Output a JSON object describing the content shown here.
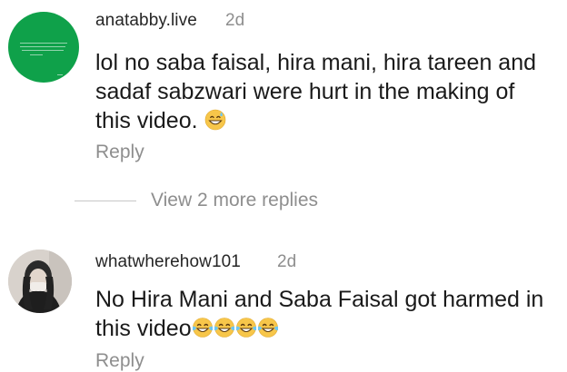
{
  "comments": [
    {
      "username": "anatabby.live",
      "time": "2d",
      "text_lines": [
        "lol no saba faisal, hira mani, hira tareen and",
        "sadaf sabzwari were hurt in the making of",
        "this video."
      ],
      "emoji": [
        "grinning-sweat-emoji"
      ],
      "reply_label": "Reply",
      "avatar": "green-square-avatar"
    },
    {
      "username": "whatwherehow101",
      "time": "2d",
      "text_lines": [
        "No Hira Mani and Saba Faisal got harmed in",
        "this video"
      ],
      "emoji": [
        "tears-of-joy-emoji",
        "tears-of-joy-emoji",
        "tears-of-joy-emoji",
        "tears-of-joy-emoji"
      ],
      "reply_label": "Reply",
      "avatar": "profile-photo-avatar"
    }
  ],
  "view_more_replies": "View 2 more replies",
  "colors": {
    "secondary_text": "#8e8e8e",
    "primary_text": "#1a1a1a",
    "avatar_green": "#0fa14a",
    "emoji_yellow": "#f7c64a"
  }
}
